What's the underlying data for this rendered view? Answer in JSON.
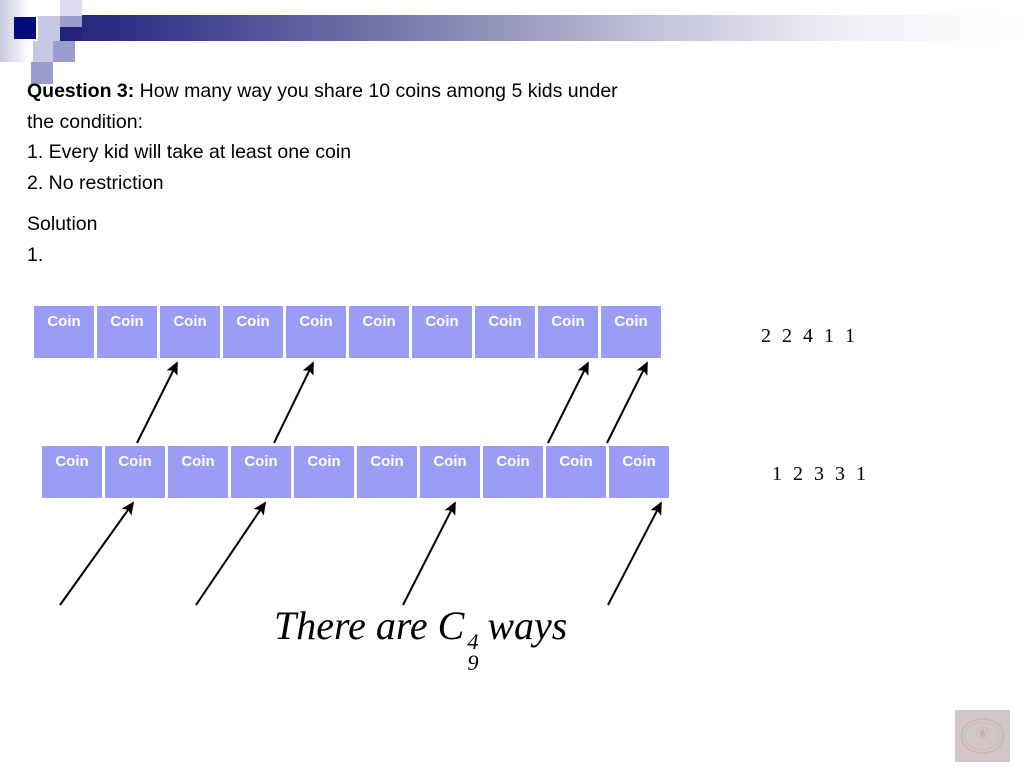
{
  "slide": {
    "question": {
      "label": "Question 3:",
      "line1": " How many way you share 10 coins among 5 kids under",
      "line2": "the condition:",
      "line3": "1. Every kid will take at least one coin",
      "line4": "2. No restriction"
    },
    "solution": {
      "heading": "Solution",
      "item": "1."
    },
    "coin_rows": [
      {
        "id": "row-1",
        "cells": [
          "Coin",
          "Coin",
          "Coin",
          "Coin",
          "Coin",
          "Coin",
          "Coin",
          "Coin",
          "Coin",
          "Coin"
        ],
        "partition_label": "2 2 4 1 1"
      },
      {
        "id": "row-2",
        "cells": [
          "Coin",
          "Coin",
          "Coin",
          "Coin",
          "Coin",
          "Coin",
          "Coin",
          "Coin",
          "Coin",
          "Coin"
        ],
        "partition_label": "1 2 3 3 1"
      }
    ],
    "conclusion": {
      "prefix": "There are C",
      "superscript": "4",
      "subscript": "9",
      "suffix": "ways"
    },
    "watermark": {
      "text_top": "MATH CIRCLE",
      "text_bottom": "OF"
    },
    "colors": {
      "coin_fill": "#9a9cf6",
      "coin_text": "#ffffff",
      "banner_dark": "#22237a",
      "accent_navy": "#010a7a",
      "arrow": "#000000"
    }
  }
}
